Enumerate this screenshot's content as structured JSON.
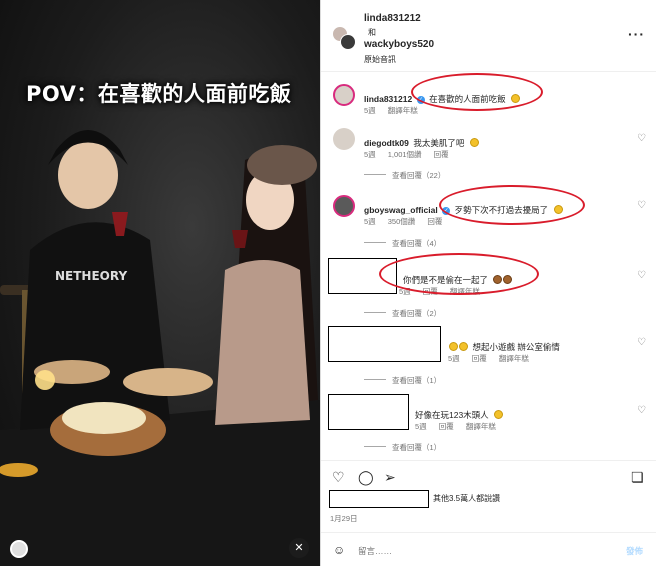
{
  "video": {
    "overlay_text": "POV：在喜歡的人面前吃飯",
    "mute_icon": "muted-speaker-icon"
  },
  "header": {
    "user1": "linda831212",
    "connector": "和",
    "user2": "wackyboys520",
    "audio": "原始音訊",
    "more_icon": "more-horizontal-icon"
  },
  "comments": [
    {
      "user": "linda831212",
      "verified": true,
      "text": "在喜歡的人面前吃飯",
      "time": "5週",
      "translate": "翻譯年糕"
    },
    {
      "user": "diegodtk09",
      "text": "我太美肌了吧",
      "time": "5週",
      "likes": "1,001個讚",
      "reply": "回覆"
    },
    {
      "user": "gboyswag_official",
      "verified": true,
      "text": "歹勢下次不打過去擾局了",
      "time": "5週",
      "likes": "350個讚",
      "reply": "回覆"
    },
    {
      "text": "你們是不是偷在一起了",
      "time": "5週",
      "reply": "回覆",
      "translate": "翻譯年糕"
    },
    {
      "text": "想起小遊戲 辦公室偷情",
      "time": "5週",
      "reply": "回覆",
      "translate": "翻譯年糕"
    },
    {
      "text": "好像在玩123木頭人",
      "time": "5週",
      "reply": "回覆",
      "translate": "翻譯年糕"
    }
  ],
  "view_replies": [
    "查看回覆（22）",
    "查看回覆（4）",
    "查看回覆（2）",
    "查看回覆（1）",
    "查看回覆（1）"
  ],
  "likes_text": "其他3.5萬人都說讚",
  "date": "1月29日",
  "composer": {
    "placeholder": "留言……",
    "post_label": "發佈"
  },
  "icons": [
    "heart-icon",
    "comment-icon",
    "share-icon",
    "bookmark-icon",
    "smile-icon"
  ],
  "colors": {
    "annotation": "#d91c2b",
    "verified": "#3897f0",
    "muted": "#737373"
  }
}
